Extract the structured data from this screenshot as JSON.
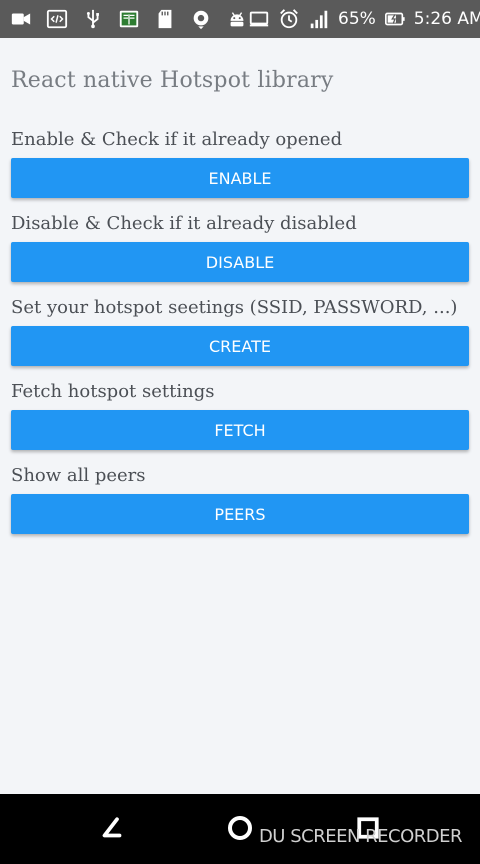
{
  "status_bar": {
    "left_icons": [
      "video-icon",
      "code-icon",
      "usb-icon",
      "book-icon",
      "sd-card-icon",
      "vpn-icon",
      "android-icon"
    ],
    "right_icons": [
      "cast-icon",
      "alarm-icon",
      "signal-icon"
    ],
    "battery_percent": "65%",
    "time": "5:26 AM"
  },
  "app": {
    "title": "React native Hotspot library",
    "sections": [
      {
        "label": "Enable & Check if it already opened",
        "button": "ENABLE"
      },
      {
        "label": "Disable & Check if it already disabled",
        "button": "DISABLE"
      },
      {
        "label": "Set your hotspot seetings (SSID, PASSWORD, ...)",
        "button": "CREATE"
      },
      {
        "label": "Fetch hotspot settings",
        "button": "FETCH"
      },
      {
        "label": "Show all peers",
        "button": "PEERS"
      }
    ]
  },
  "colors": {
    "button": "#2196f3",
    "status_bar": "#5a5a5a",
    "background": "#f3f5f8"
  },
  "nav_bar": {
    "buttons": [
      "back-icon",
      "home-icon",
      "recents-icon"
    ],
    "watermark": "DU SCREEN RECORDER"
  }
}
